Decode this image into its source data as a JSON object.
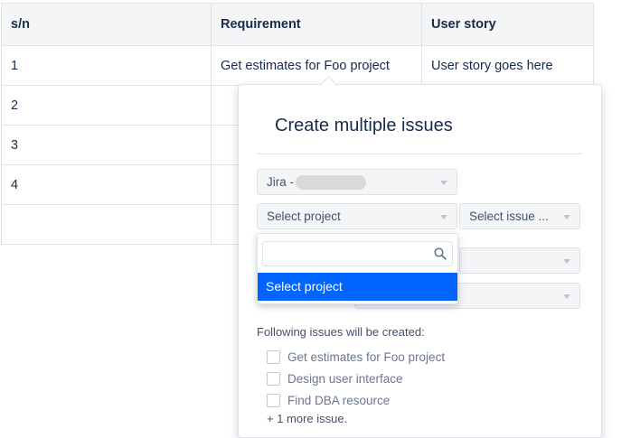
{
  "table": {
    "headers": [
      "s/n",
      "Requirement",
      "User story"
    ],
    "rows": [
      [
        "1",
        "Get estimates for Foo project",
        "User story goes here"
      ],
      [
        "2",
        "",
        ""
      ],
      [
        "3",
        "",
        ""
      ],
      [
        "4",
        "",
        ""
      ],
      [
        "",
        "",
        ""
      ]
    ]
  },
  "dialog": {
    "title": "Create multiple issues",
    "jira_select_label": "Jira -",
    "project_select_label": "Select project",
    "issue_type_select_label": "Select issue ...",
    "following_text": "Following issues will be created:",
    "issues": [
      "Get estimates for Foo project",
      "Design user interface",
      "Find DBA resource"
    ],
    "more_text": "+ 1 more issue."
  },
  "dropdown": {
    "search_placeholder": "",
    "options": [
      "Select project"
    ],
    "selected_option": "Select project"
  },
  "colors": {
    "accent": "#0065ff",
    "header_bg": "#f4f5f7",
    "border": "#dfe1e6",
    "text": "#172b4d"
  }
}
